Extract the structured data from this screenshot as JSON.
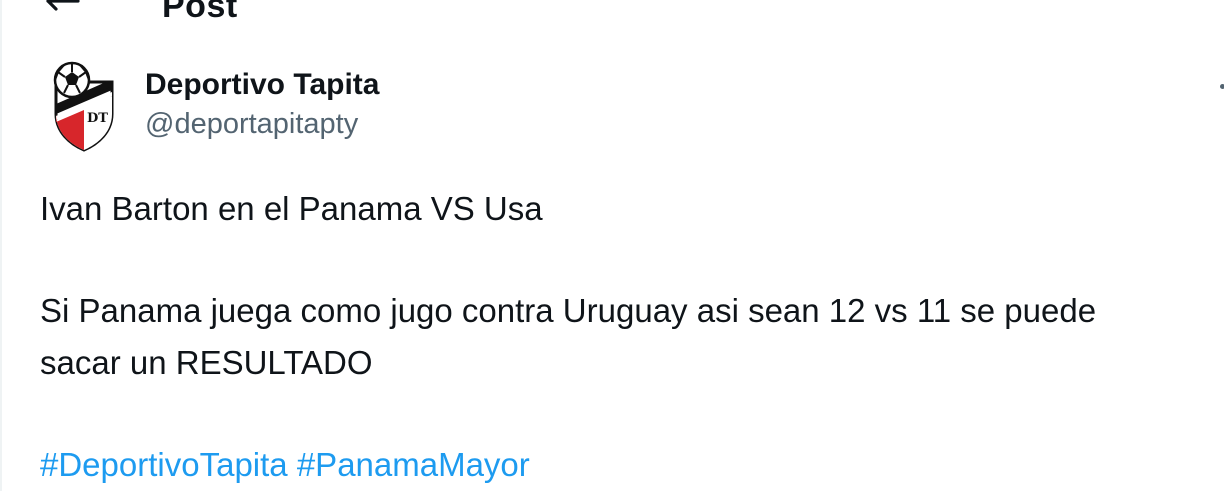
{
  "header": {
    "title": "Post",
    "back_icon": "arrow-left-icon"
  },
  "author": {
    "display_name": "Deportivo Tapita",
    "handle": "@deportapitapty",
    "avatar_icon": "club-crest-logo",
    "avatar_colors": {
      "red": "#d7262b",
      "black": "#111111",
      "white": "#ffffff"
    }
  },
  "tweet": {
    "line1": "Ivan Barton en el Panama VS Usa",
    "line2": "Si Panama juega como jugo contra Uruguay asi sean 12 vs 11 se puede",
    "line3": "sacar un RESULTADO",
    "hashtags": [
      "#DeportivoTapita",
      "#PanamaMayor"
    ]
  },
  "colors": {
    "text": "#0f1419",
    "secondary": "#536471",
    "link": "#1d9bf0"
  },
  "more_icon": "more-options-icon"
}
